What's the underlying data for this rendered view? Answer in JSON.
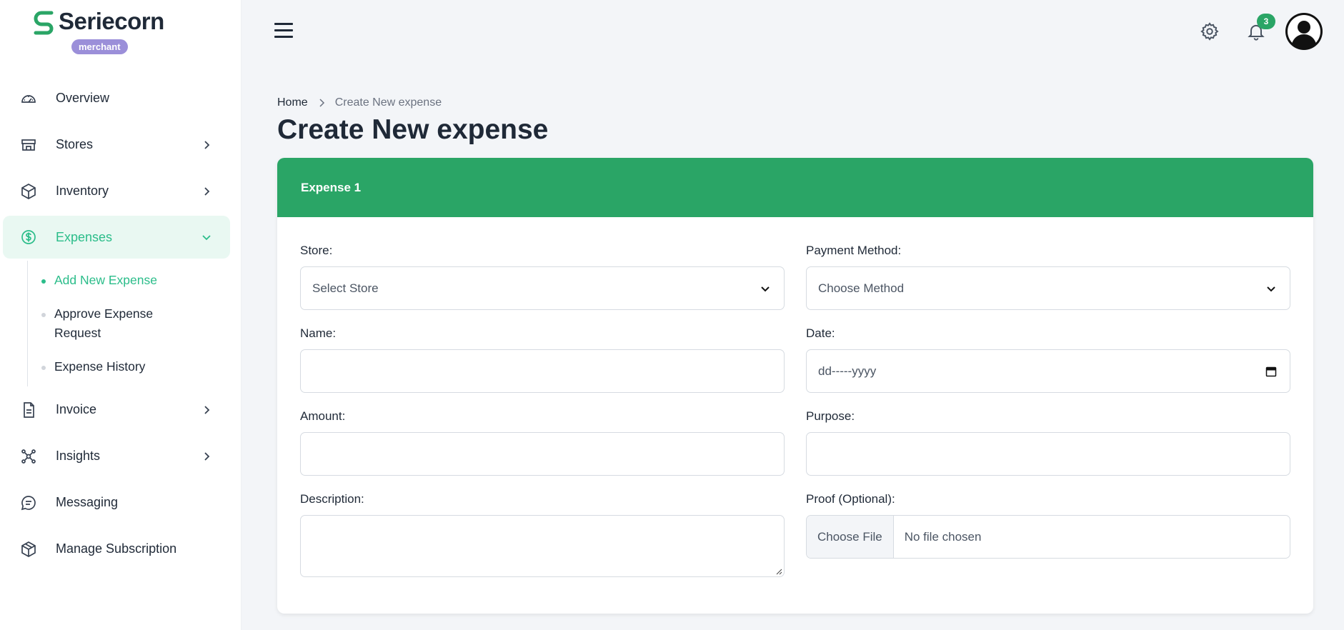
{
  "brand": {
    "name": "Seriecorn",
    "role_badge": "merchant"
  },
  "sidebar": {
    "items": [
      {
        "label": "Overview",
        "icon": "gauge-icon",
        "has_chevron": false
      },
      {
        "label": "Stores",
        "icon": "store-icon",
        "has_chevron": true
      },
      {
        "label": "Inventory",
        "icon": "box-icon",
        "has_chevron": true
      },
      {
        "label": "Expenses",
        "icon": "dollar-circle-icon",
        "has_chevron": true,
        "active": true
      },
      {
        "label": "Invoice",
        "icon": "document-icon",
        "has_chevron": true
      },
      {
        "label": "Insights",
        "icon": "network-icon",
        "has_chevron": true
      },
      {
        "label": "Messaging",
        "icon": "chat-icon",
        "has_chevron": false
      },
      {
        "label": "Manage Subscription",
        "icon": "package-icon",
        "has_chevron": false
      }
    ],
    "expenses_submenu": [
      {
        "label": "Add New Expense",
        "active": true
      },
      {
        "label": "Approve Expense Request",
        "active": false
      },
      {
        "label": "Expense History",
        "active": false
      }
    ]
  },
  "topbar": {
    "notification_count": "3"
  },
  "breadcrumb": {
    "home": "Home",
    "current": "Create New expense"
  },
  "page": {
    "title": "Create New expense"
  },
  "form": {
    "header": "Expense 1",
    "store": {
      "label": "Store:",
      "placeholder": "Select Store"
    },
    "payment_method": {
      "label": "Payment Method:",
      "placeholder": "Choose Method"
    },
    "name": {
      "label": "Name:",
      "value": ""
    },
    "date": {
      "label": "Date:",
      "placeholder": "dd-----yyyy"
    },
    "amount": {
      "label": "Amount:",
      "value": ""
    },
    "purpose": {
      "label": "Purpose:",
      "value": ""
    },
    "description": {
      "label": "Description:",
      "value": ""
    },
    "proof": {
      "label": "Proof (Optional):",
      "button": "Choose File",
      "status": "No file chosen"
    }
  },
  "colors": {
    "accent_green": "#2aa566",
    "active_teal": "#2bbd8a",
    "badge_purple": "#9b8fd9"
  }
}
